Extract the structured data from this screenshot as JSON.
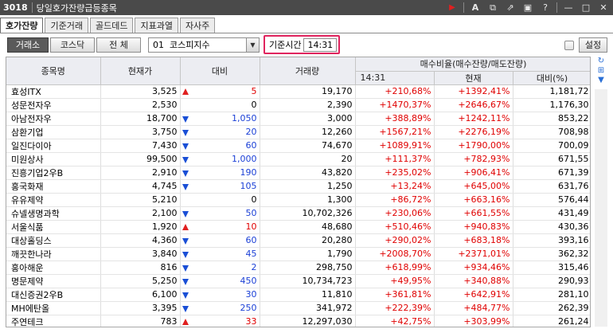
{
  "window": {
    "screen_no": "3018",
    "title": "당일호가잔량급등종목"
  },
  "tabs": [
    "호가잔량",
    "기준거래",
    "골드데드",
    "지표과열",
    "자사주"
  ],
  "filters": {
    "market_buttons": [
      "거래소",
      "코스닥",
      "전 체"
    ],
    "index_select": "01  코스피지수",
    "base_time_label": "기준시간",
    "base_time_value": "14:31",
    "settings_label": "설정"
  },
  "table": {
    "headers": {
      "name": "종목명",
      "price": "현재가",
      "change": "대비",
      "volume": "거래량",
      "ratio_group": "매수비율(매수잔량/매도잔량)",
      "ratio_base": "14:31",
      "ratio_current": "현재",
      "ratio_diff": "대비(%)"
    },
    "rows": [
      {
        "name": "효성ITX",
        "price": "3,525",
        "dir": "up",
        "change": "5",
        "volume": "19,170",
        "base": "+210,68%",
        "current": "+1392,41%",
        "diff": "1,181,72"
      },
      {
        "name": "성문전자우",
        "price": "2,530",
        "dir": "none",
        "change": "0",
        "volume": "2,390",
        "base": "+1470,37%",
        "current": "+2646,67%",
        "diff": "1,176,30"
      },
      {
        "name": "아남전자우",
        "price": "18,700",
        "dir": "down",
        "change": "1,050",
        "volume": "3,000",
        "base": "+388,89%",
        "current": "+1242,11%",
        "diff": "853,22"
      },
      {
        "name": "삼환기업",
        "price": "3,750",
        "dir": "down",
        "change": "20",
        "volume": "12,260",
        "base": "+1567,21%",
        "current": "+2276,19%",
        "diff": "708,98"
      },
      {
        "name": "일진다이아",
        "price": "7,430",
        "dir": "down",
        "change": "60",
        "volume": "74,670",
        "base": "+1089,91%",
        "current": "+1790,00%",
        "diff": "700,09"
      },
      {
        "name": "미원상사",
        "price": "99,500",
        "dir": "down",
        "change": "1,000",
        "volume": "20",
        "base": "+111,37%",
        "current": "+782,93%",
        "diff": "671,55"
      },
      {
        "name": "진흥기업2우B",
        "price": "2,910",
        "dir": "down",
        "change": "190",
        "volume": "43,820",
        "base": "+235,02%",
        "current": "+906,41%",
        "diff": "671,39"
      },
      {
        "name": "홍국화재",
        "price": "4,745",
        "dir": "down",
        "change": "105",
        "volume": "1,250",
        "base": "+13,24%",
        "current": "+645,00%",
        "diff": "631,76"
      },
      {
        "name": "유유제약",
        "price": "5,210",
        "dir": "none",
        "change": "0",
        "volume": "1,300",
        "base": "+86,72%",
        "current": "+663,16%",
        "diff": "576,44"
      },
      {
        "name": "슈넬생명과학",
        "price": "2,100",
        "dir": "down",
        "change": "50",
        "volume": "10,702,326",
        "base": "+230,06%",
        "current": "+661,55%",
        "diff": "431,49"
      },
      {
        "name": "서울식품",
        "price": "1,920",
        "dir": "up",
        "change": "10",
        "volume": "48,680",
        "base": "+510,46%",
        "current": "+940,83%",
        "diff": "430,36"
      },
      {
        "name": "대상홀딩스",
        "price": "4,360",
        "dir": "down",
        "change": "60",
        "volume": "20,280",
        "base": "+290,02%",
        "current": "+683,18%",
        "diff": "393,16"
      },
      {
        "name": "깨끗한나라",
        "price": "3,840",
        "dir": "down",
        "change": "45",
        "volume": "1,790",
        "base": "+2008,70%",
        "current": "+2371,01%",
        "diff": "362,32"
      },
      {
        "name": "홍아해운",
        "price": "816",
        "dir": "down",
        "change": "2",
        "volume": "298,750",
        "base": "+618,99%",
        "current": "+934,46%",
        "diff": "315,46"
      },
      {
        "name": "명문제약",
        "price": "5,250",
        "dir": "down",
        "change": "450",
        "volume": "10,734,723",
        "base": "+49,95%",
        "current": "+340,88%",
        "diff": "290,93"
      },
      {
        "name": "대신증권2우B",
        "price": "6,100",
        "dir": "down",
        "change": "30",
        "volume": "11,810",
        "base": "+361,81%",
        "current": "+642,91%",
        "diff": "281,10"
      },
      {
        "name": "MH에탄올",
        "price": "3,395",
        "dir": "down",
        "change": "250",
        "volume": "341,972",
        "base": "+222,39%",
        "current": "+484,77%",
        "diff": "262,39"
      },
      {
        "name": "주연테크",
        "price": "783",
        "dir": "up",
        "change": "33",
        "volume": "12,297,030",
        "base": "+42,75%",
        "current": "+303,99%",
        "diff": "261,24"
      }
    ]
  },
  "colors": {
    "up": "#e02020",
    "down": "#1a4fd6",
    "highlight_border": "#e0245e"
  }
}
